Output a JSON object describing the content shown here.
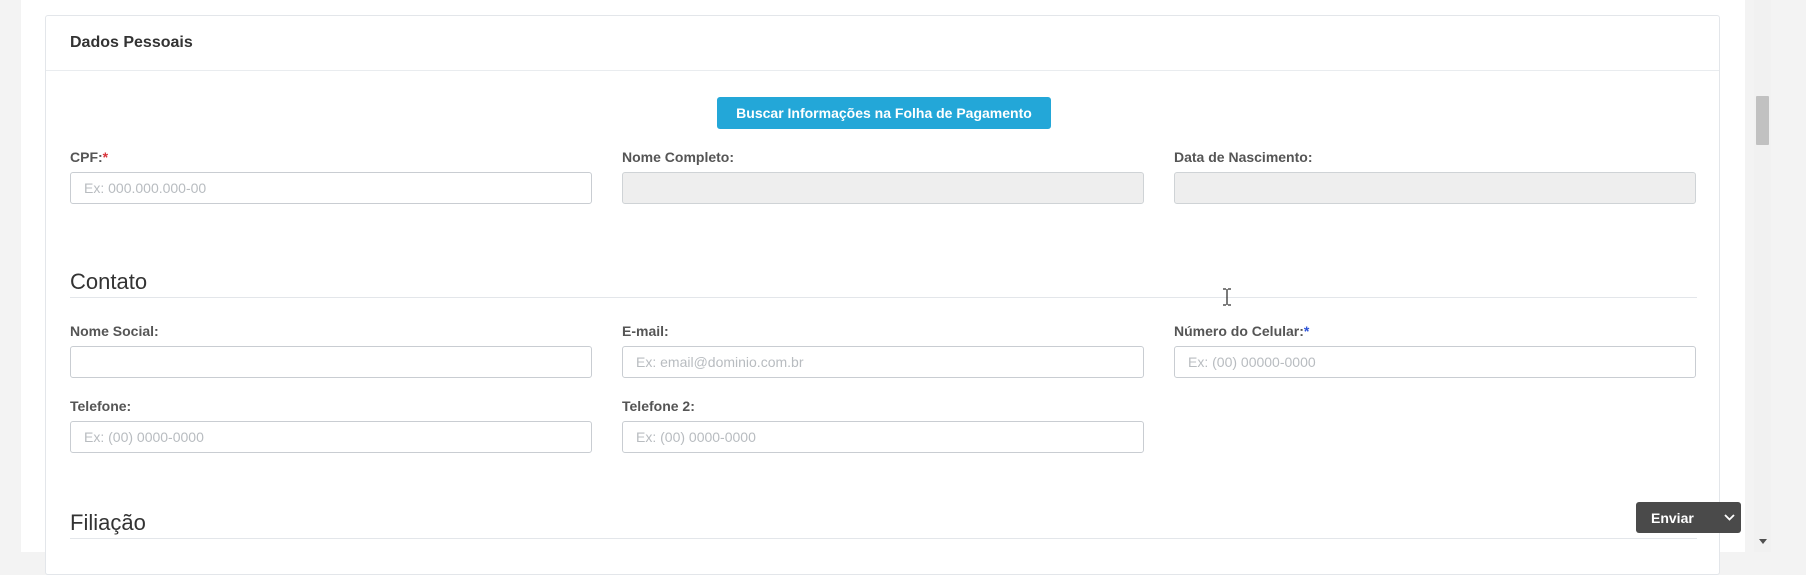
{
  "panel": {
    "title": "Dados Pessoais",
    "fetch_button": "Buscar Informações na Folha de Pagamento"
  },
  "personal": {
    "cpf_label": "CPF:",
    "cpf_required": "*",
    "cpf_placeholder": "Ex: 000.000.000-00",
    "name_label": "Nome Completo:",
    "birth_label": "Data de Nascimento:"
  },
  "contact": {
    "section_title": "Contato",
    "social_name_label": "Nome Social:",
    "email_label": "E-mail:",
    "email_placeholder": "Ex: email@dominio.com.br",
    "mobile_label": "Número do Celular:",
    "mobile_required": "*",
    "mobile_placeholder": "Ex: (00) 00000-0000",
    "phone_label": "Telefone:",
    "phone_placeholder": "Ex: (00) 0000-0000",
    "phone2_label": "Telefone 2:",
    "phone2_placeholder": "Ex: (00) 0000-0000"
  },
  "filiation": {
    "section_title": "Filiação"
  },
  "actions": {
    "send_label": "Enviar"
  },
  "icons": {
    "cursor": "text-cursor-icon",
    "send_caret": "chevron-down-icon",
    "scroll_down": "arrow-down-icon"
  },
  "colors": {
    "primary_button": "#23a7d8",
    "required_red": "#d9343b",
    "required_blue": "#2e54d8",
    "send_button": "#4a4a4a"
  }
}
